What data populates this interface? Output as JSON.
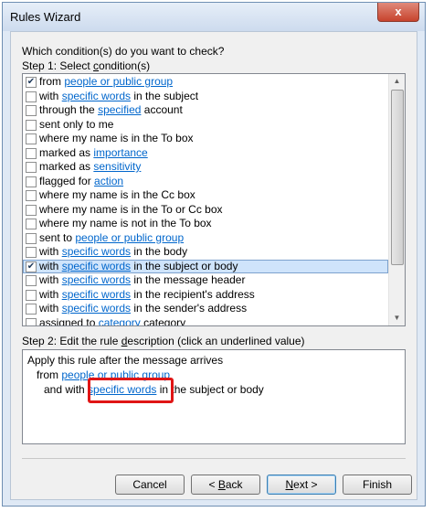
{
  "window": {
    "title": "Rules Wizard",
    "close_glyph": "x"
  },
  "question": "Which condition(s) do you want to check?",
  "step1": {
    "prefix": "Step 1: Select ",
    "key": "c",
    "suffix": "ondition(s)"
  },
  "conditions": [
    {
      "checked": true,
      "pre": "from ",
      "link": "people or public group",
      "post": ""
    },
    {
      "checked": false,
      "pre": "with ",
      "link": "specific words",
      "post": " in the subject"
    },
    {
      "checked": false,
      "pre": "through the ",
      "link": "specified",
      "post": " account"
    },
    {
      "checked": false,
      "pre": "sent only to me",
      "link": "",
      "post": ""
    },
    {
      "checked": false,
      "pre": "where my name is in the To box",
      "link": "",
      "post": ""
    },
    {
      "checked": false,
      "pre": "marked as ",
      "link": "importance",
      "post": ""
    },
    {
      "checked": false,
      "pre": "marked as ",
      "link": "sensitivity",
      "post": ""
    },
    {
      "checked": false,
      "pre": "flagged for ",
      "link": "action",
      "post": ""
    },
    {
      "checked": false,
      "pre": "where my name is in the Cc box",
      "link": "",
      "post": ""
    },
    {
      "checked": false,
      "pre": "where my name is in the To or Cc box",
      "link": "",
      "post": ""
    },
    {
      "checked": false,
      "pre": "where my name is not in the To box",
      "link": "",
      "post": ""
    },
    {
      "checked": false,
      "pre": "sent to ",
      "link": "people or public group",
      "post": ""
    },
    {
      "checked": false,
      "pre": "with ",
      "link": "specific words",
      "post": " in the body"
    },
    {
      "checked": true,
      "pre": "with ",
      "link": "specific words",
      "post": " in the subject or body",
      "selected": true
    },
    {
      "checked": false,
      "pre": "with ",
      "link": "specific words",
      "post": " in the message header"
    },
    {
      "checked": false,
      "pre": "with ",
      "link": "specific words",
      "post": " in the recipient's address"
    },
    {
      "checked": false,
      "pre": "with ",
      "link": "specific words",
      "post": " in the sender's address"
    },
    {
      "checked": false,
      "pre": "assigned to ",
      "link": "category",
      "post": " category"
    }
  ],
  "step2": {
    "prefix": "Step 2: Edit the rule ",
    "key": "d",
    "suffix": "escription (click an underlined value)"
  },
  "description": {
    "line1": "Apply this rule after the message arrives",
    "line2_pre": "from ",
    "line2_link": "people or public group",
    "line3_pre": "and with ",
    "line3_link": "specific words",
    "line3_post": " in the subject or body"
  },
  "buttons": {
    "cancel": "Cancel",
    "back": {
      "pre": "< ",
      "key": "B",
      "post": "ack"
    },
    "next": {
      "key": "N",
      "post": "ext >"
    },
    "finish": "Finish"
  },
  "colors": {
    "link": "#0066cc",
    "highlight": "#e01515",
    "selected_row": "#cfe4fb"
  }
}
